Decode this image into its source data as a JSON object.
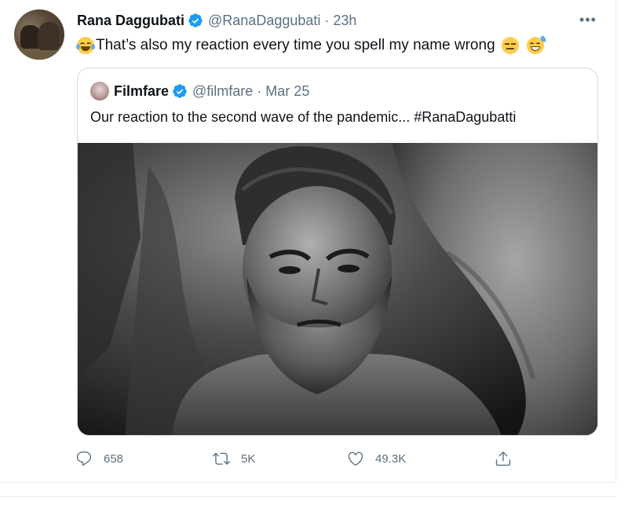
{
  "author": {
    "name": "Rana Daggubati",
    "handle_time": "@RanaDaggubati · 23h"
  },
  "tweet": {
    "text": "That’s also my reaction every time you spell my name wrong"
  },
  "quoted": {
    "name": "Filmfare",
    "handle_time": "@filmfare · Mar 25",
    "text": "Our reaction to the second wave of the pandemic... #RanaDagubatti"
  },
  "metrics": {
    "replies": "658",
    "retweets": "5K",
    "likes": "49.3K"
  },
  "colors": {
    "verified": "#1d9bf0",
    "secondary_text": "#5b7083",
    "border": "#cfd9de"
  },
  "icons": [
    "verified-badge-icon",
    "more-icon",
    "reply-icon",
    "retweet-icon",
    "like-icon",
    "share-icon"
  ]
}
